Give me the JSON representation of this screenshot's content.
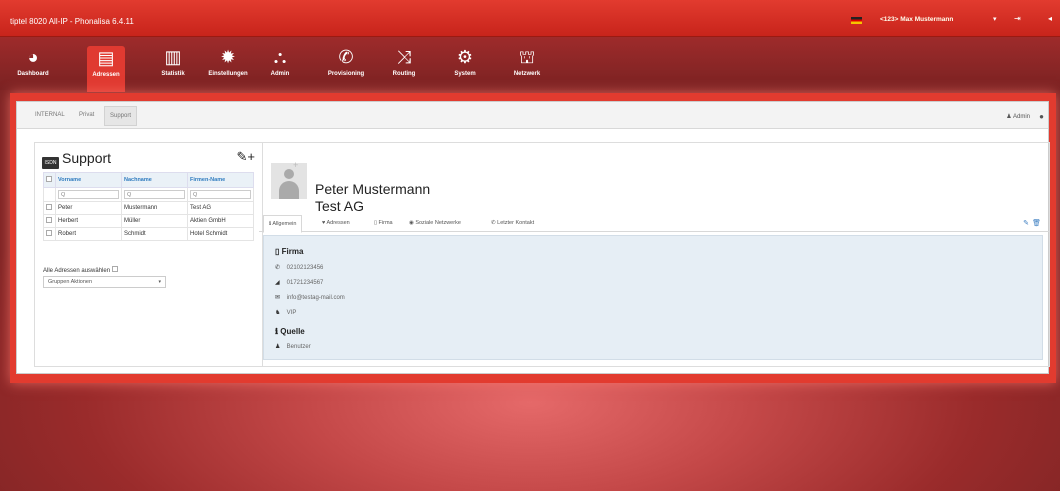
{
  "app": {
    "title": "tiptel 8020 All-IP - Phonalisa 6.4.11"
  },
  "topbar": {
    "user": "<123> Max Mustermann",
    "caret": "▾",
    "logout_glyph": "⇥",
    "more_glyph": "◂"
  },
  "nav": {
    "items": [
      {
        "label": "Dashboard",
        "icon": "dashboard-icon",
        "glyph": "◕"
      },
      {
        "label": "Adressen",
        "icon": "address-book-icon",
        "glyph": "▤"
      },
      {
        "label": "Statistik",
        "icon": "bar-chart-icon",
        "glyph": "▥"
      },
      {
        "label": "Einstellungen",
        "icon": "gear-icon",
        "glyph": "✹"
      },
      {
        "label": "Admin",
        "icon": "users-icon",
        "glyph": "⛬"
      },
      {
        "label": "Provisioning",
        "icon": "phone-icon",
        "glyph": "✆"
      },
      {
        "label": "Routing",
        "icon": "shuffle-icon",
        "glyph": "⤨"
      },
      {
        "label": "System",
        "icon": "gears-icon",
        "glyph": "⚙"
      },
      {
        "label": "Netzwerk",
        "icon": "network-icon",
        "glyph": "⛫"
      }
    ],
    "active_index": 1
  },
  "subtabs": {
    "items": [
      "INTERNAL",
      "Privat",
      "Support"
    ],
    "active": "Support",
    "admin": "♟ Admin",
    "info_glyph": "●"
  },
  "left": {
    "title": "Support",
    "folder_label": "ISDN",
    "tools_glyph": "✎+",
    "columns": [
      "Vorname",
      "Nachname",
      "Firmen-Name"
    ],
    "search_glyph": "Q",
    "rows": [
      [
        "Peter",
        "Mustermann",
        "Test AG"
      ],
      [
        "Herbert",
        "Müller",
        "Aktien GmbH"
      ],
      [
        "Robert",
        "Schmidt",
        "Hotel Schmidt"
      ]
    ],
    "select_all": "Alle Adressen auswählen",
    "group_actions": "Gruppen Aktionen",
    "dropdown_caret": "▾"
  },
  "contact": {
    "full_name": "Peter Mustermann",
    "company": "Test AG",
    "avatar_plus": "+",
    "tabs": [
      "ℹ Allgemein",
      "♥ Adressen",
      "▯ Firma",
      "◉ Soziale Netzwerke",
      "✆ Letzter Kontakt"
    ],
    "edit_glyph": "✎",
    "trash_glyph": "🗑",
    "section_firma": "Firma",
    "firma_glyph": "▯",
    "phone": "02102123456",
    "mobile": "01721234567",
    "email": "info@testag-mail.com",
    "vip": "VIP",
    "glyph_phone": "✆",
    "glyph_mobile": "◢",
    "glyph_email": "✉",
    "glyph_vip": "♞",
    "section_quelle": "Quelle",
    "quelle_glyph": "ℹ",
    "source": "Benutzer",
    "glyph_source": "♟"
  }
}
